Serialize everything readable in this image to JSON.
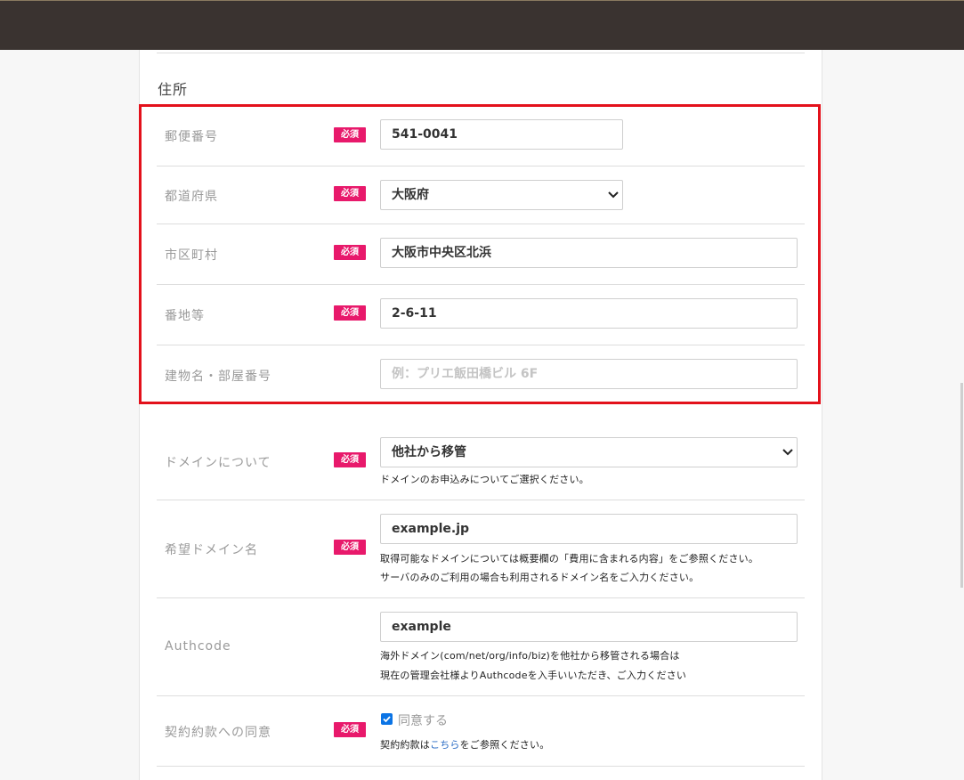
{
  "section": {
    "title": "住所"
  },
  "address": {
    "postal": {
      "label": "郵便番号",
      "badge": "必須",
      "value": "541-0041"
    },
    "prefecture": {
      "label": "都道府県",
      "badge": "必須",
      "value": "大阪府"
    },
    "city": {
      "label": "市区町村",
      "badge": "必須",
      "value": "大阪市中央区北浜"
    },
    "street": {
      "label": "番地等",
      "badge": "必須",
      "value": "2-6-11"
    },
    "building": {
      "label": "建物名・部屋番号",
      "placeholder": "例：プリエ飯田橋ビル 6F",
      "value": ""
    }
  },
  "domain": {
    "option": {
      "label": "ドメインについて",
      "badge": "必須",
      "value": "他社から移管",
      "help": "ドメインのお申込みについてご選択ください。"
    },
    "name": {
      "label": "希望ドメイン名",
      "badge": "必須",
      "value": "example.jp",
      "help1": "取得可能なドメインについては概要欄の「費用に含まれる内容」をご参照ください。",
      "help2": "サーバのみのご利用の場合も利用されるドメイン名をご入力ください。"
    },
    "authcode": {
      "label": "Authcode",
      "value": "example",
      "help1": "海外ドメイン(com/net/org/info/biz)を他社から移管される場合は",
      "help2": "現在の管理会社様よりAuthcodeを入手いいただき、ご入力ください"
    }
  },
  "agreement": {
    "label": "契約約款への同意",
    "badge": "必須",
    "checkbox_label": "同意する",
    "checked": true,
    "help_prefix": "契約約款は",
    "help_link": "こちら",
    "help_suffix": "をご参照ください。"
  },
  "colors": {
    "badge": "#e8196b",
    "highlight": "#e3111b",
    "header": "#3a3330",
    "link": "#2b6cc4",
    "checkbox": "#0b74e5"
  }
}
